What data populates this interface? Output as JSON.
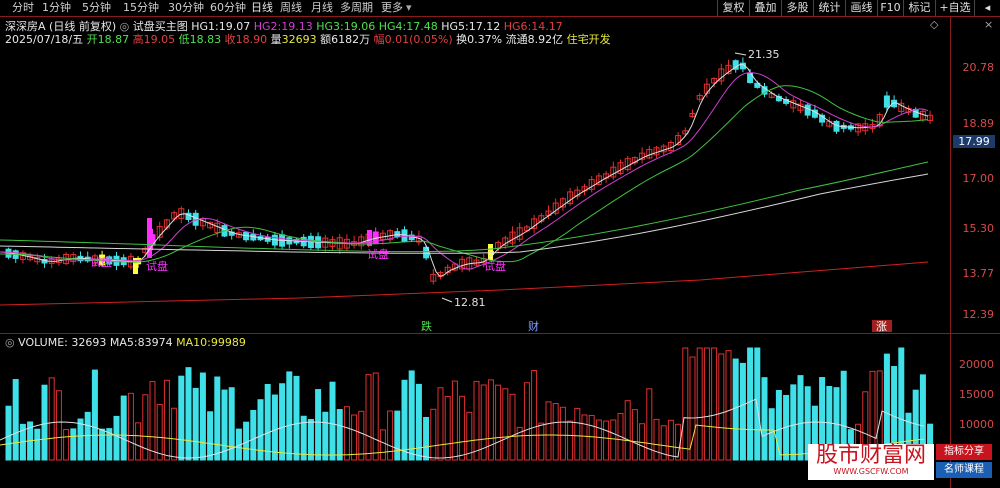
{
  "toolbar": {
    "periods": [
      "分时",
      "1分钟",
      "5分钟",
      "15分钟",
      "30分钟",
      "60分钟",
      "日线",
      "周线",
      "月线",
      "多周期",
      "更多"
    ],
    "active_period": "日线",
    "right_buttons": [
      "复权",
      "叠加",
      "多股",
      "统计",
      "画线",
      "F10",
      "标记",
      "+自选"
    ]
  },
  "header": {
    "stock_name": "深深房A",
    "mode": "(日线 前复权)",
    "indicator_name": "试盘买主图",
    "hg": [
      {
        "label": "HG1:",
        "value": "19.07",
        "color": "#e8e8e8"
      },
      {
        "label": "HG2:",
        "value": "19.13",
        "color": "#d040d0"
      },
      {
        "label": "HG3:",
        "value": "19.06",
        "color": "#50e050"
      },
      {
        "label": "HG4:",
        "value": "17.48",
        "color": "#50e050"
      },
      {
        "label": "HG5:",
        "value": "17.12",
        "color": "#e8e8e8"
      },
      {
        "label": "HG6:",
        "value": "14.17",
        "color": "#e04040"
      }
    ],
    "date": "2025/07/18/五",
    "open_label": "开",
    "open": "18.87",
    "high_label": "高",
    "high": "19.05",
    "low_label": "低",
    "low": "18.83",
    "close_label": "收",
    "close": "18.90",
    "volume_label": "量",
    "volume": "32693",
    "amount_label": "额",
    "amount": "6182万",
    "change_label": "幅",
    "change": "0.01(0.05%)",
    "turnover_label": "换",
    "turnover": "0.37%",
    "float_label": "流通",
    "float_value": "8.92亿",
    "sector": "住宅开发"
  },
  "price_axis": [
    "20.78",
    "18.89",
    "17.00",
    "15.30",
    "13.77",
    "12.39"
  ],
  "current_price": "17.99",
  "annotations": {
    "high": "21.35",
    "low": "12.81",
    "signal": "试盘",
    "events": [
      "跌",
      "财",
      "涨"
    ]
  },
  "volume_header": {
    "label": "VOLUME:",
    "value": "32693",
    "ma5_label": "MA5:",
    "ma5": "83974",
    "ma10_label": "MA10:",
    "ma10": "99989"
  },
  "volume_axis": [
    "20000",
    "15000",
    "10000"
  ],
  "watermark": {
    "title": "股市财富网",
    "url": "WWW.GSCFW.COM",
    "tags": [
      "指标分享",
      "名师课程"
    ]
  },
  "colors": {
    "up": "#e03030",
    "down": "#40e0e8",
    "axis": "#d84a4a",
    "signal": "#ff30ff",
    "signal_buy": "#ffff40",
    "ma_white": "#e0e0e0",
    "ma_magenta": "#d040d0",
    "ma_green": "#40c040",
    "ma_red": "#d02020"
  }
}
